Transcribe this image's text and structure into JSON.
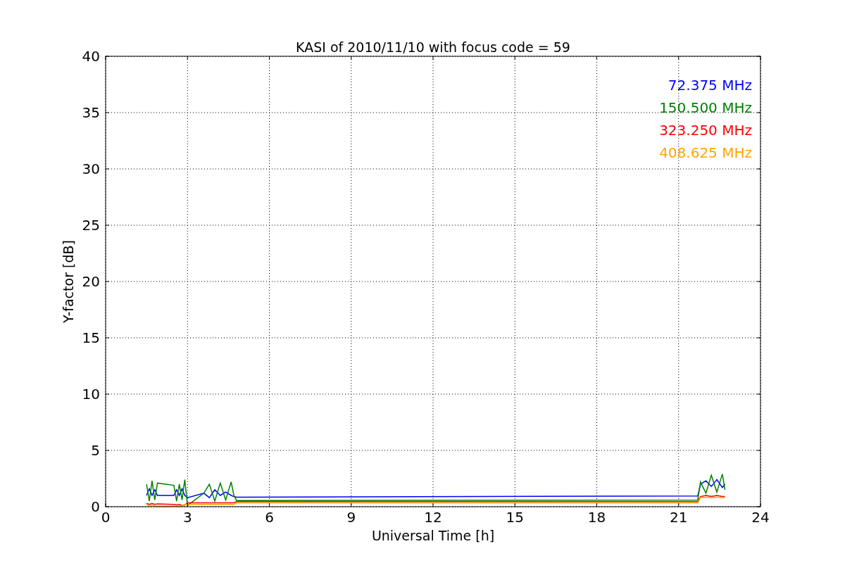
{
  "chart_data": {
    "type": "line",
    "title": "KASI of 2010/11/10 with focus code = 59",
    "xlabel": "Universal Time [h]",
    "ylabel": "Y-factor [dB]",
    "x": [
      1.5,
      1.6,
      1.7,
      1.8,
      1.9,
      2.5,
      2.6,
      2.7,
      2.8,
      2.9,
      3.0,
      3.6,
      3.8,
      4.0,
      4.2,
      4.4,
      4.6,
      4.7,
      4.8,
      21.7,
      21.8,
      22.0,
      22.2,
      22.4,
      22.6,
      22.7
    ],
    "series": [
      {
        "name": "72.375 MHz",
        "color": "#0000ff",
        "values": [
          1.0,
          1.6,
          1.0,
          1.5,
          1.0,
          1.0,
          1.5,
          1.0,
          1.6,
          1.0,
          0.8,
          1.2,
          0.8,
          1.5,
          1.0,
          1.3,
          1.0,
          0.9,
          0.85,
          0.95,
          2.0,
          2.3,
          1.8,
          2.4,
          1.7,
          2.0
        ]
      },
      {
        "name": "150.500 MHz",
        "color": "#008000",
        "values": [
          2.0,
          0.5,
          2.3,
          0.6,
          2.1,
          1.9,
          0.5,
          2.0,
          0.6,
          2.4,
          0.1,
          1.2,
          2.0,
          0.5,
          2.1,
          0.6,
          2.2,
          1.0,
          0.55,
          0.6,
          2.2,
          1.2,
          2.8,
          1.3,
          2.9,
          1.5
        ]
      },
      {
        "name": "323.250 MHz",
        "color": "#ff0000",
        "values": [
          0.3,
          0.2,
          0.3,
          0.2,
          0.25,
          0.2,
          0.15,
          0.2,
          0.1,
          0.15,
          0.35,
          0.35,
          0.35,
          0.35,
          0.35,
          0.35,
          0.35,
          0.35,
          0.45,
          0.45,
          0.9,
          1.0,
          0.9,
          1.0,
          0.9,
          0.9
        ]
      },
      {
        "name": "408.625 MHz",
        "color": "#ffa500",
        "values": [
          0.2,
          0.1,
          0.15,
          0.05,
          0.05,
          0.05,
          0.05,
          0.05,
          0.05,
          0.2,
          0.2,
          0.2,
          0.2,
          0.2,
          0.2,
          0.2,
          0.2,
          0.2,
          0.35,
          0.35,
          0.8,
          0.85,
          0.8,
          0.85,
          0.8,
          0.8
        ]
      }
    ],
    "xlim": [
      0,
      24
    ],
    "ylim": [
      0,
      40
    ],
    "xticks": [
      0,
      3,
      6,
      9,
      12,
      15,
      18,
      21,
      24
    ],
    "yticks": [
      0,
      5,
      10,
      15,
      20,
      25,
      30,
      35,
      40
    ],
    "grid": true
  }
}
